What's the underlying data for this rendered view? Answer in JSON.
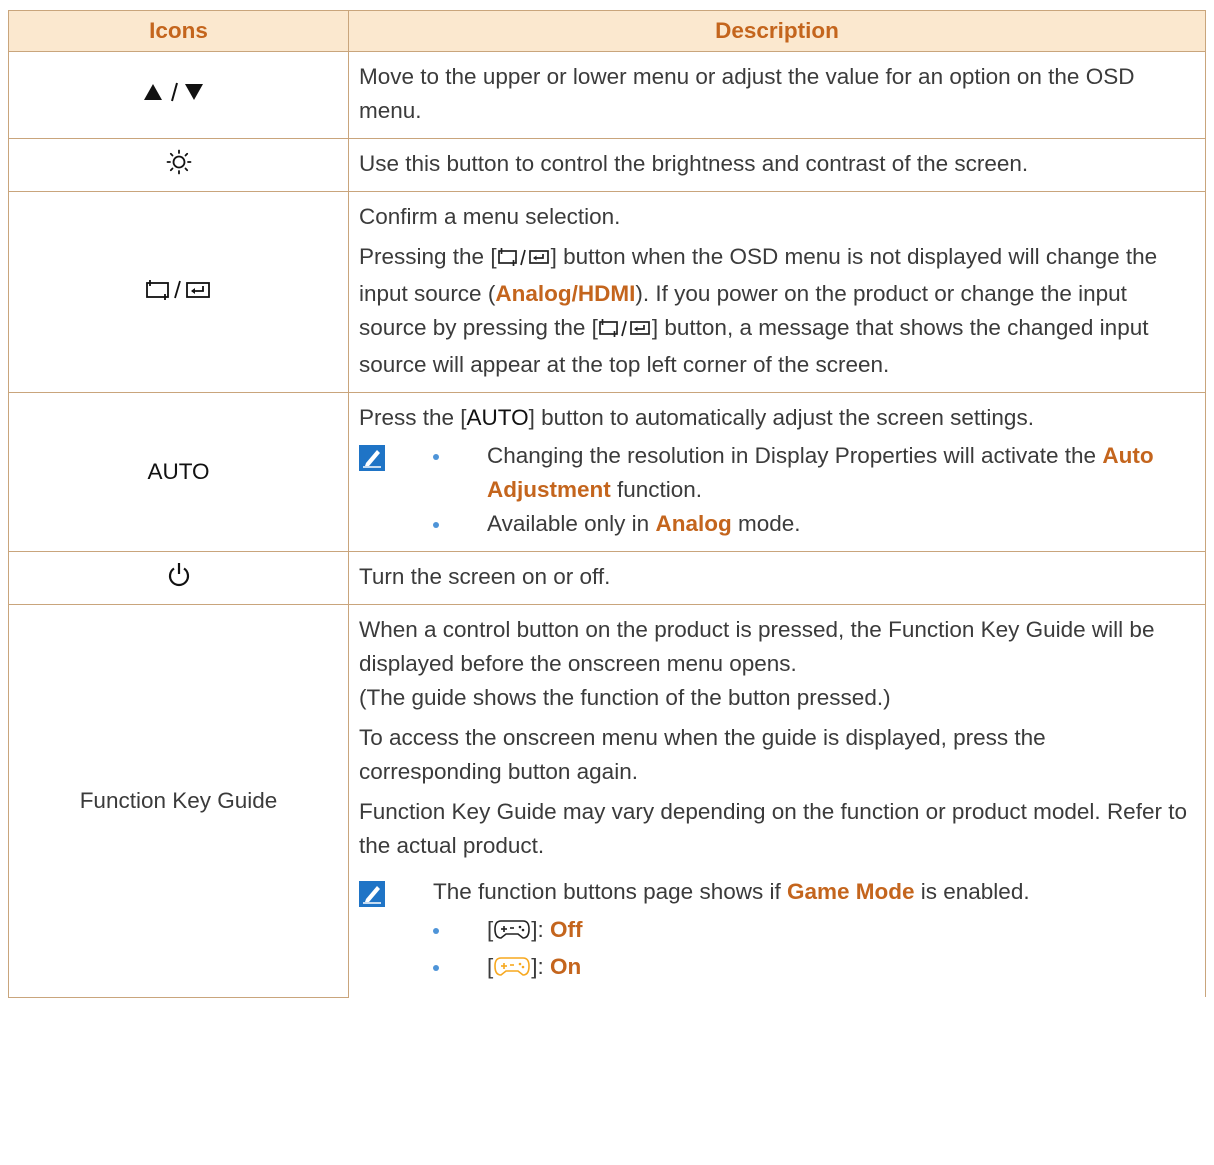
{
  "table": {
    "headers": [
      "Icons",
      "Description"
    ],
    "rows": {
      "updown": {
        "icon_name": "up-down-triangle-icons",
        "desc": "Move to the upper or lower menu or adjust the value for an option on the OSD menu."
      },
      "brightness": {
        "icon_name": "brightness-sun-icon",
        "desc": "Use this button to control the brightness and contrast of the screen."
      },
      "source": {
        "icon_name": "source-enter-icons",
        "p1": "Confirm a menu selection.",
        "p2_a": "Pressing the [",
        "p2_b": "] button when the OSD menu is not displayed will change the input source (",
        "analog": "Analog",
        "slash": "/",
        "hdmi": "HDMI",
        "p2_c": "). If you power on the product or change the input source by pressing the [",
        "p2_d": "] button, a message that shows the changed input source will appear at the top left corner of the screen."
      },
      "auto": {
        "label": "AUTO",
        "p1_a": "Press the [",
        "p1_key": "AUTO",
        "p1_b": "] button to automatically adjust the screen settings.",
        "note_b1_a": "Changing the resolution in Display Properties will activate the ",
        "note_b1_hl": "Auto Adjustment",
        "note_b1_b": " function.",
        "note_b2_a": "Available only in ",
        "note_b2_hl": "Analog",
        "note_b2_b": " mode."
      },
      "power": {
        "icon_name": "power-icon",
        "desc": "Turn the screen on or off."
      },
      "guide": {
        "label": "Function Key Guide",
        "p1": "When a control button on the product is pressed, the Function Key Guide will be displayed before the onscreen menu opens.",
        "p1b": "(The guide shows the function of the button pressed.)",
        "p2": "To access the onscreen menu when the guide is displayed, press the corresponding button again.",
        "p3": "Function Key Guide may vary depending on the function or product model. Refer to the actual product.",
        "note_a": "The function buttons page shows if ",
        "note_hl": "Game Mode",
        "note_b": " is enabled.",
        "off_open": "[",
        "off_close": "]: ",
        "off_label": "Off",
        "on_open": "[",
        "on_close": "]: ",
        "on_label": "On"
      }
    }
  },
  "colors": {
    "header_bg": "#fbe8cf",
    "header_text": "#c4651d",
    "border": "#c9a57c",
    "highlight": "#c4651d",
    "highlight_on": "#f7a81f",
    "bullet": "#4e94d8",
    "note_icon": "#1f74c6"
  }
}
